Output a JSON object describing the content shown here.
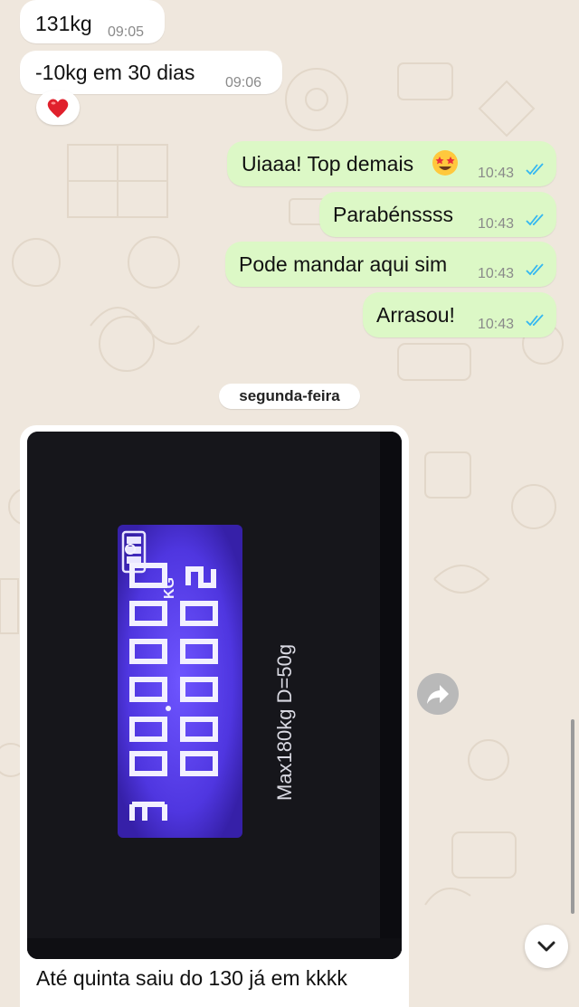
{
  "messages": [
    {
      "text": "131kg",
      "time": "09:05",
      "direction": "incoming"
    },
    {
      "text": "-10kg em 30 dias",
      "time": "09:06",
      "direction": "incoming",
      "reaction": "❤️"
    },
    {
      "text": "Uiaaa! Top demais",
      "emoji": "🤩",
      "time": "10:43",
      "direction": "outgoing",
      "status": "read"
    },
    {
      "text": "Parabénssss",
      "time": "10:43",
      "direction": "outgoing",
      "status": "read"
    },
    {
      "text": "Pode mandar aqui sim",
      "time": "10:43",
      "direction": "outgoing",
      "status": "read"
    },
    {
      "text": "Arrasou!",
      "time": "10:43",
      "direction": "outgoing",
      "status": "read"
    }
  ],
  "day_separator": "segunda-feira",
  "image_message": {
    "scale_text": "Max180kg D=50g",
    "display_unit": "KG",
    "display_reading": "130.0",
    "caption": "Até quinta saiu do 130 já em kkkk"
  },
  "colors": {
    "chat_background": "#efe7dd",
    "outgoing_bubble": "#dcf8c6",
    "incoming_bubble": "#ffffff",
    "read_ticks": "#34b7f1",
    "scale_display": "#5b3df0"
  },
  "icons": {
    "forward": "forward-arrow-icon",
    "scroll_down": "chevron-down-icon",
    "read_receipt": "double-check-icon"
  }
}
